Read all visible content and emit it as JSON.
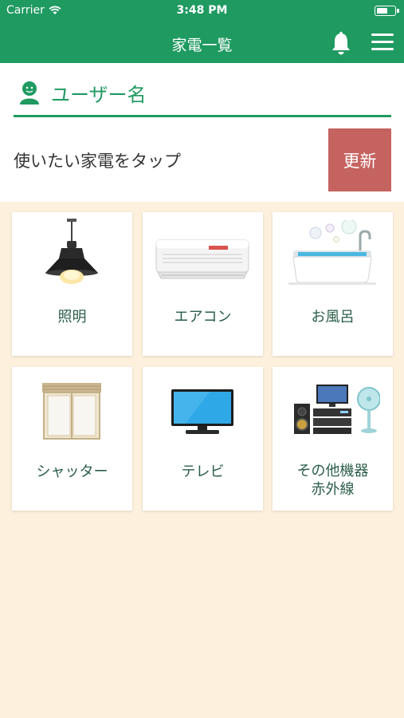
{
  "status_bar": {
    "carrier": "Carrier",
    "time": "3:48 PM",
    "battery_level": 0.65
  },
  "nav": {
    "title": "家電一覧"
  },
  "user": {
    "name": "ユーザー名"
  },
  "instruction": "使いたい家電をタップ",
  "refresh_label": "更新",
  "appliances": [
    {
      "label": "照明"
    },
    {
      "label": "エアコン"
    },
    {
      "label": "お風呂"
    },
    {
      "label": "シャッター"
    },
    {
      "label": "テレビ"
    },
    {
      "label_line1": "その他機器",
      "label_line2": "赤外線"
    }
  ],
  "colors": {
    "primary": "#1f9a61",
    "refresh": "#c56360",
    "background": "#fdf0dc",
    "label": "#2b5e4a"
  }
}
